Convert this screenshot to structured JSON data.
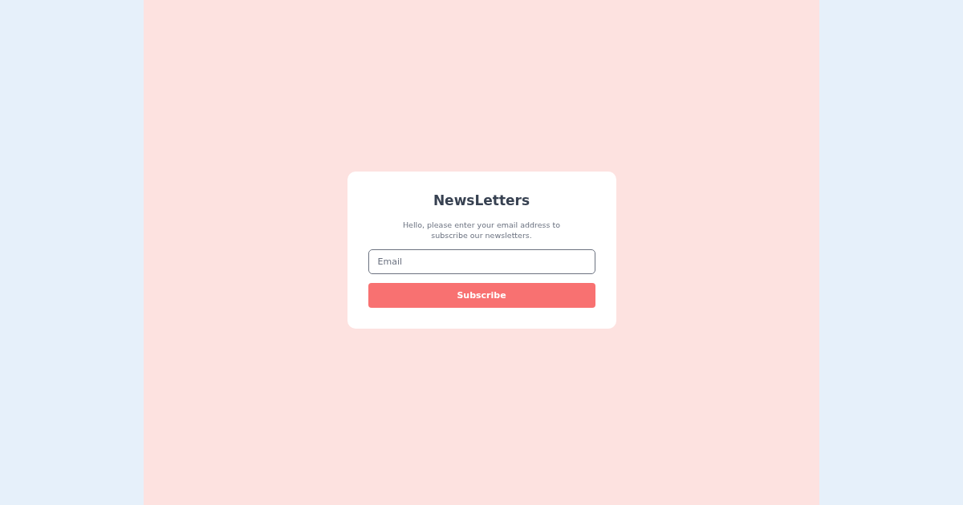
{
  "newsletter": {
    "title": "NewsLetters",
    "description": "Hello, please enter your email address to subscribe our newsletters.",
    "email": {
      "placeholder": "Email"
    },
    "button": "Subscribe"
  }
}
